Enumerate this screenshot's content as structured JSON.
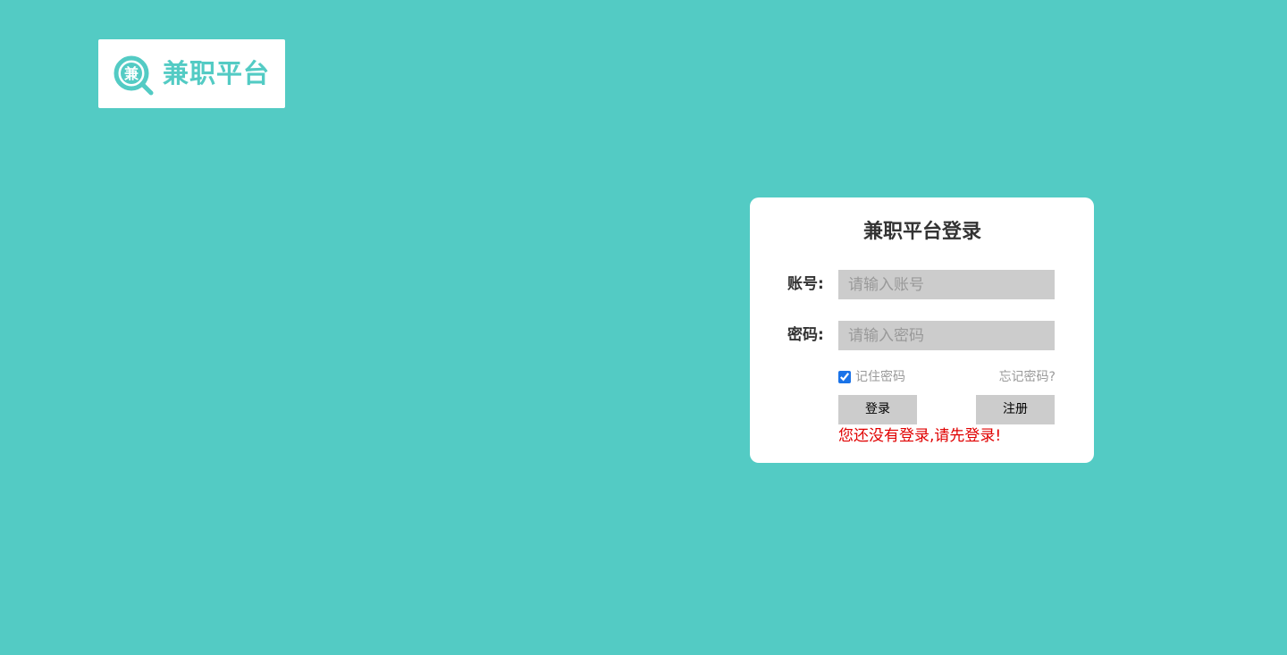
{
  "logo": {
    "icon_char": "兼",
    "text": "兼职平台"
  },
  "login": {
    "title": "兼职平台登录",
    "account_label": "账号:",
    "account_placeholder": "请输入账号",
    "password_label": "密码:",
    "password_placeholder": "请输入密码",
    "remember_label": "记住密码",
    "remember_checked": true,
    "forgot_label": "忘记密码?",
    "login_button": "登录",
    "register_button": "注册",
    "warning": "您还没有登录,请先登录!"
  },
  "colors": {
    "background": "#53cbc4",
    "brand": "#53cbc4",
    "input_bg": "#cccccc",
    "warning": "#e00000"
  }
}
